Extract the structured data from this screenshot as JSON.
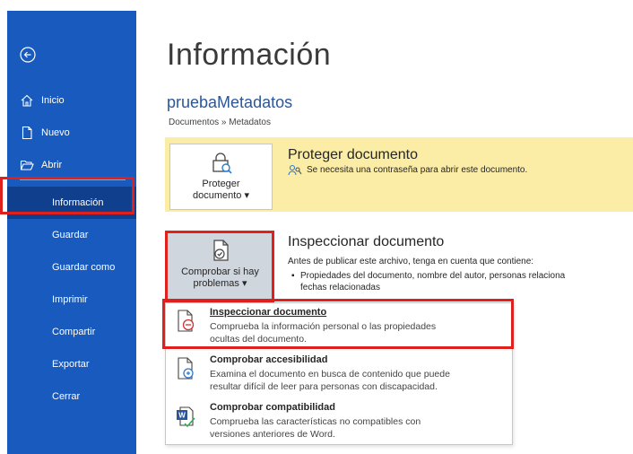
{
  "sidebar": {
    "top_items": [
      {
        "label": "Inicio",
        "icon": "home-icon"
      },
      {
        "label": "Nuevo",
        "icon": "new-document-icon"
      },
      {
        "label": "Abrir",
        "icon": "folder-open-icon"
      }
    ],
    "items": [
      {
        "label": "Información",
        "selected": true
      },
      {
        "label": "Guardar"
      },
      {
        "label": "Guardar como"
      },
      {
        "label": "Imprimir"
      },
      {
        "label": "Compartir"
      },
      {
        "label": "Exportar"
      },
      {
        "label": "Cerrar"
      }
    ],
    "color": "#185abd",
    "selected_color": "#0f3f8d"
  },
  "main": {
    "title": "Información",
    "document_name": "pruebaMetadatos",
    "breadcrumb": "Documentos » Metadatos"
  },
  "protect": {
    "button_line1": "Proteger",
    "button_line2": "documento ▾",
    "title": "Proteger documento",
    "description": "Se necesita una contraseña para abrir este documento.",
    "band_color": "#fbeca6"
  },
  "inspect": {
    "button_line1": "Comprobar si hay",
    "button_line2": "problemas ▾",
    "title": "Inspeccionar documento",
    "description": "Antes de publicar este archivo, tenga en cuenta que contiene:",
    "bullet": "Propiedades del documento, nombre del autor, personas relaciona",
    "bullet_cont": "fechas relacionadas"
  },
  "dropdown": {
    "items": [
      {
        "title": "Inspeccionar documento",
        "desc_line1": "Comprueba la información personal o las propiedades",
        "desc_line2": "ocultas del documento."
      },
      {
        "title": "Comprobar accesibilidad",
        "desc_line1": "Examina el documento en busca de contenido que puede",
        "desc_line2": "resultar difícil de leer para personas con discapacidad."
      },
      {
        "title": "Comprobar compatibilidad",
        "desc_line1": "Comprueba las características no compatibles con",
        "desc_line2": "versiones anteriores de Word."
      }
    ]
  },
  "highlight_color": "#e0201d"
}
